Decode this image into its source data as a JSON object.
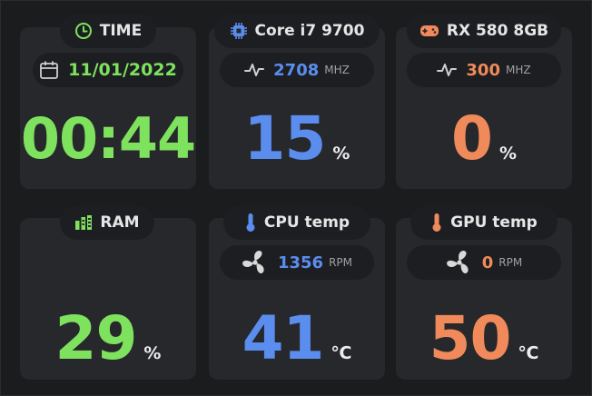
{
  "colors": {
    "green": "#7ee25f",
    "blue": "#5b8def",
    "orange": "#f08a5b",
    "card": "#27282b",
    "pill": "#1d1e21"
  },
  "time": {
    "title": "TIME",
    "date": "11/01/2022",
    "value": "00:44",
    "icons": {
      "title": "clock-icon",
      "date": "calendar-icon"
    }
  },
  "cpu": {
    "title": "Core i7 9700",
    "clock_value": "2708",
    "clock_unit": "MHZ",
    "usage_value": "15",
    "usage_unit": "%",
    "icons": {
      "title": "cpu-chip-icon",
      "clock": "pulse-icon"
    }
  },
  "gpu": {
    "title": "RX 580 8GB",
    "clock_value": "300",
    "clock_unit": "MHZ",
    "usage_value": "0",
    "usage_unit": "%",
    "icons": {
      "title": "gamepad-icon",
      "clock": "pulse-icon"
    }
  },
  "ram": {
    "title": "RAM",
    "usage_value": "29",
    "usage_unit": "%",
    "icons": {
      "title": "memory-icon"
    }
  },
  "cpu_temp": {
    "title": "CPU temp",
    "fan_value": "1356",
    "fan_unit": "RPM",
    "temp_value": "41",
    "temp_unit": "℃",
    "icons": {
      "title": "thermometer-icon",
      "fan": "fan-icon"
    }
  },
  "gpu_temp": {
    "title": "GPU temp",
    "fan_value": "0",
    "fan_unit": "RPM",
    "temp_value": "50",
    "temp_unit": "℃",
    "icons": {
      "title": "thermometer-icon",
      "fan": "fan-icon"
    }
  }
}
